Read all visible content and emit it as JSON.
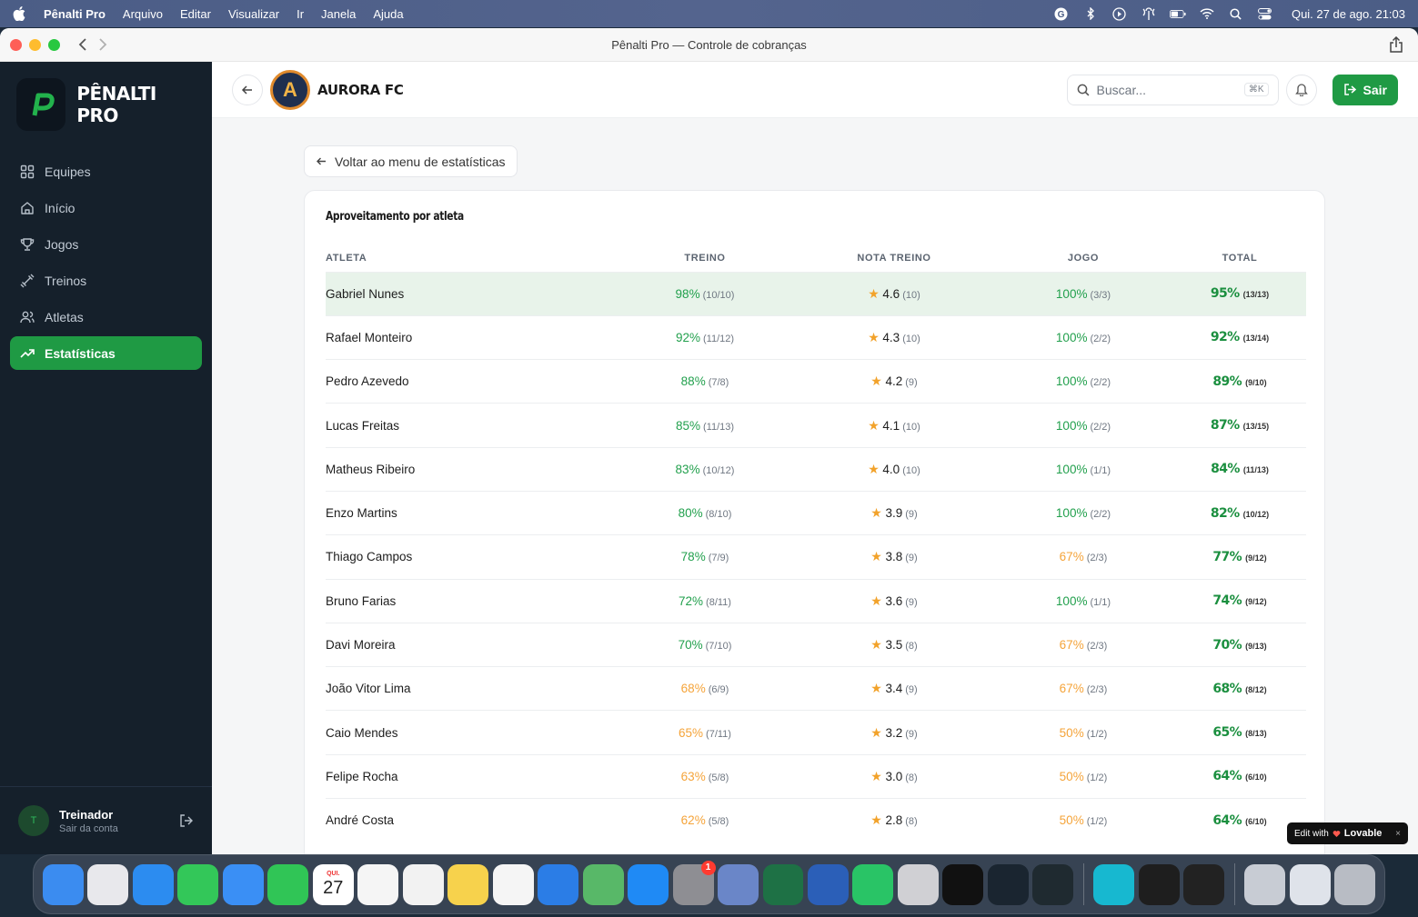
{
  "menubar": {
    "app_name": "Pênalti Pro",
    "items": [
      "Arquivo",
      "Editar",
      "Visualizar",
      "Ir",
      "Janela",
      "Ajuda"
    ],
    "clock": "Qui. 27 de ago.  21:03"
  },
  "window": {
    "title": "Pênalti Pro — Controle de cobranças"
  },
  "sidebar": {
    "brand": "PÊNALTI PRO",
    "items": [
      {
        "label": "Equipes",
        "icon": "grid-icon"
      },
      {
        "label": "Início",
        "icon": "home-icon"
      },
      {
        "label": "Jogos",
        "icon": "trophy-icon"
      },
      {
        "label": "Treinos",
        "icon": "dumbbell-icon"
      },
      {
        "label": "Atletas",
        "icon": "users-icon"
      },
      {
        "label": "Estatísticas",
        "icon": "trending-up-icon"
      }
    ],
    "user": {
      "initial": "T",
      "name": "Treinador",
      "sub": "Sair da conta"
    }
  },
  "topbar": {
    "team_initial": "A",
    "team_name": "AURORA FC",
    "search_placeholder": "Buscar...",
    "search_shortcut": "⌘K",
    "logout_label": "Sair"
  },
  "back_menu_label": "Voltar ao menu de estatísticas",
  "card": {
    "title": "Aproveitamento por atleta",
    "headers": [
      "ATLETA",
      "TREINO",
      "NOTA TREINO",
      "JOGO",
      "TOTAL"
    ],
    "rows": [
      {
        "name": "Gabriel Nunes",
        "treino_pct": "98%",
        "treino_frac": "(10/10)",
        "nota": "4.6",
        "nota_n": "(10)",
        "jogo_pct": "100%",
        "jogo_frac": "(3/3)",
        "total_pct": "95%",
        "total_frac": "(13/13)",
        "treino_color": "green",
        "jogo_color": "green"
      },
      {
        "name": "Rafael Monteiro",
        "treino_pct": "92%",
        "treino_frac": "(11/12)",
        "nota": "4.3",
        "nota_n": "(10)",
        "jogo_pct": "100%",
        "jogo_frac": "(2/2)",
        "total_pct": "92%",
        "total_frac": "(13/14)",
        "treino_color": "green",
        "jogo_color": "green"
      },
      {
        "name": "Pedro Azevedo",
        "treino_pct": "88%",
        "treino_frac": "(7/8)",
        "nota": "4.2",
        "nota_n": "(9)",
        "jogo_pct": "100%",
        "jogo_frac": "(2/2)",
        "total_pct": "89%",
        "total_frac": "(9/10)",
        "treino_color": "green",
        "jogo_color": "green"
      },
      {
        "name": "Lucas Freitas",
        "treino_pct": "85%",
        "treino_frac": "(11/13)",
        "nota": "4.1",
        "nota_n": "(10)",
        "jogo_pct": "100%",
        "jogo_frac": "(2/2)",
        "total_pct": "87%",
        "total_frac": "(13/15)",
        "treino_color": "green",
        "jogo_color": "green"
      },
      {
        "name": "Matheus Ribeiro",
        "treino_pct": "83%",
        "treino_frac": "(10/12)",
        "nota": "4.0",
        "nota_n": "(10)",
        "jogo_pct": "100%",
        "jogo_frac": "(1/1)",
        "total_pct": "84%",
        "total_frac": "(11/13)",
        "treino_color": "green",
        "jogo_color": "green"
      },
      {
        "name": "Enzo Martins",
        "treino_pct": "80%",
        "treino_frac": "(8/10)",
        "nota": "3.9",
        "nota_n": "(9)",
        "jogo_pct": "100%",
        "jogo_frac": "(2/2)",
        "total_pct": "82%",
        "total_frac": "(10/12)",
        "treino_color": "green",
        "jogo_color": "green"
      },
      {
        "name": "Thiago Campos",
        "treino_pct": "78%",
        "treino_frac": "(7/9)",
        "nota": "3.8",
        "nota_n": "(9)",
        "jogo_pct": "67%",
        "jogo_frac": "(2/3)",
        "total_pct": "77%",
        "total_frac": "(9/12)",
        "treino_color": "green",
        "jogo_color": "orange"
      },
      {
        "name": "Bruno Farias",
        "treino_pct": "72%",
        "treino_frac": "(8/11)",
        "nota": "3.6",
        "nota_n": "(9)",
        "jogo_pct": "100%",
        "jogo_frac": "(1/1)",
        "total_pct": "74%",
        "total_frac": "(9/12)",
        "treino_color": "green",
        "jogo_color": "green"
      },
      {
        "name": "Davi Moreira",
        "treino_pct": "70%",
        "treino_frac": "(7/10)",
        "nota": "3.5",
        "nota_n": "(8)",
        "jogo_pct": "67%",
        "jogo_frac": "(2/3)",
        "total_pct": "70%",
        "total_frac": "(9/13)",
        "treino_color": "green",
        "jogo_color": "orange"
      },
      {
        "name": "João Vitor Lima",
        "treino_pct": "68%",
        "treino_frac": "(6/9)",
        "nota": "3.4",
        "nota_n": "(9)",
        "jogo_pct": "67%",
        "jogo_frac": "(2/3)",
        "total_pct": "68%",
        "total_frac": "(8/12)",
        "treino_color": "orange",
        "jogo_color": "orange"
      },
      {
        "name": "Caio Mendes",
        "treino_pct": "65%",
        "treino_frac": "(7/11)",
        "nota": "3.2",
        "nota_n": "(9)",
        "jogo_pct": "50%",
        "jogo_frac": "(1/2)",
        "total_pct": "65%",
        "total_frac": "(8/13)",
        "treino_color": "orange",
        "jogo_color": "orange"
      },
      {
        "name": "Felipe Rocha",
        "treino_pct": "63%",
        "treino_frac": "(5/8)",
        "nota": "3.0",
        "nota_n": "(8)",
        "jogo_pct": "50%",
        "jogo_frac": "(1/2)",
        "total_pct": "64%",
        "total_frac": "(6/10)",
        "treino_color": "orange",
        "jogo_color": "orange"
      },
      {
        "name": "André Costa",
        "treino_pct": "62%",
        "treino_frac": "(5/8)",
        "nota": "2.8",
        "nota_n": "(8)",
        "jogo_pct": "50%",
        "jogo_frac": "(1/2)",
        "total_pct": "64%",
        "total_frac": "(6/10)",
        "treino_color": "orange",
        "jogo_color": "orange"
      }
    ]
  },
  "lovable_badge": {
    "prefix": "Edit with",
    "brand": "Lovable",
    "close": "×"
  },
  "dock": {
    "calendar_month": "QUI.",
    "calendar_day": "27",
    "settings_badge": "1",
    "apps": [
      {
        "name": "finder-icon",
        "color": "#3b8cf0"
      },
      {
        "name": "launchpad-icon",
        "color": "#e8e8ec"
      },
      {
        "name": "safari-icon",
        "color": "#2c8cf0"
      },
      {
        "name": "messages-icon",
        "color": "#33c759"
      },
      {
        "name": "mail-icon",
        "color": "#3a8ff5"
      },
      {
        "name": "facetime-icon",
        "color": "#30c556"
      },
      {
        "name": "calendar-icon",
        "color": "#ffffff"
      },
      {
        "name": "reminders-icon",
        "color": "#f5f5f5"
      },
      {
        "name": "photos-icon",
        "color": "#f2f2f2"
      },
      {
        "name": "notes-icon",
        "color": "#f7d24c"
      },
      {
        "name": "freeform-icon",
        "color": "#f5f5f5"
      },
      {
        "name": "keynote-icon",
        "color": "#2b7de6"
      },
      {
        "name": "maps-icon",
        "color": "#58b868"
      },
      {
        "name": "appstore-icon",
        "color": "#1f8af5"
      },
      {
        "name": "settings-icon",
        "color": "#8e8e93"
      },
      {
        "name": "iphone-mirroring-icon",
        "color": "#6a86c8"
      },
      {
        "name": "excel-icon",
        "color": "#1e7145"
      },
      {
        "name": "word-icon",
        "color": "#2b5fb8"
      },
      {
        "name": "whatsapp-icon",
        "color": "#29c466"
      },
      {
        "name": "b-app-icon",
        "color": "#d0d0d4"
      },
      {
        "name": "360-app-icon",
        "color": "#111111"
      },
      {
        "name": "penalti-pro-icon",
        "color": "#1a2530"
      },
      {
        "name": "perplexity-icon",
        "color": "#1f2a30"
      },
      {
        "name": "canva-icon",
        "color": "#17b8d0"
      },
      {
        "name": "figma-icon",
        "color": "#1e1e1e"
      },
      {
        "name": "activity-monitor-icon",
        "color": "#222222"
      },
      {
        "name": "documents-icon",
        "color": "#c8ccd4"
      },
      {
        "name": "screenshot-icon",
        "color": "#dfe3ea"
      },
      {
        "name": "trash-icon",
        "color": "#b8bcc4"
      }
    ]
  }
}
